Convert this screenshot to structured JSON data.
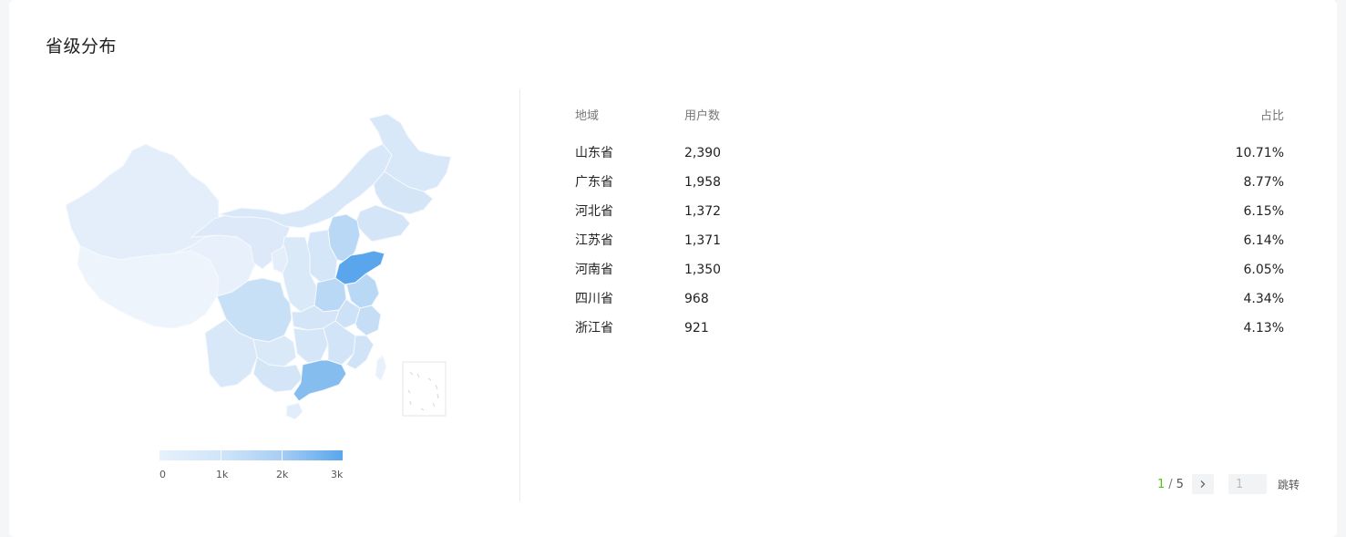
{
  "card": {
    "title": "省级分布"
  },
  "legend": {
    "labels": [
      "0",
      "1k",
      "2k",
      "3k"
    ],
    "max": 3000
  },
  "table": {
    "headers": {
      "region": "地域",
      "users": "用户数",
      "ratio": "占比"
    },
    "rows": [
      {
        "region": "山东省",
        "users": "2,390",
        "ratio": "10.71%"
      },
      {
        "region": "广东省",
        "users": "1,958",
        "ratio": "8.77%"
      },
      {
        "region": "河北省",
        "users": "1,372",
        "ratio": "6.15%"
      },
      {
        "region": "江苏省",
        "users": "1,371",
        "ratio": "6.14%"
      },
      {
        "region": "河南省",
        "users": "1,350",
        "ratio": "6.05%"
      },
      {
        "region": "四川省",
        "users": "968",
        "ratio": "4.34%"
      },
      {
        "region": "浙江省",
        "users": "921",
        "ratio": "4.13%"
      }
    ]
  },
  "pager": {
    "current": "1",
    "separator": "/",
    "total": "5",
    "next_icon": "chevron-right-icon",
    "input_value": "1",
    "jump_label": "跳转"
  },
  "colors": {
    "low": "#e6f1fc",
    "mid": "#cfe4f9",
    "high": "#a9cff4",
    "top": "#5aa6ec",
    "active_page": "#52c41a"
  }
}
